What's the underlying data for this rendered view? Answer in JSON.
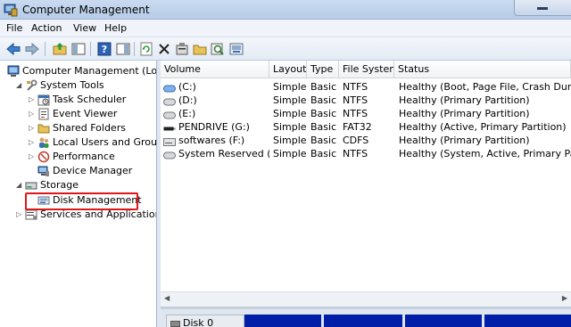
{
  "window": {
    "title": "Computer Management"
  },
  "menubar": {
    "items": [
      "File",
      "Action",
      "View",
      "Help"
    ]
  },
  "toolbar": {
    "icons": [
      "back-arrow-icon",
      "forward-arrow-icon",
      "up-folder-icon",
      "show-hide-tree-icon",
      "help-icon",
      "console-tree-icon",
      "refresh-icon",
      "delete-icon",
      "properties-icon",
      "open-folder-icon",
      "search-disk-icon",
      "disk-icon"
    ]
  },
  "tree": {
    "root": "Computer Management (Local",
    "system_tools": "System Tools",
    "task_scheduler": "Task Scheduler",
    "event_viewer": "Event Viewer",
    "shared_folders": "Shared Folders",
    "local_users": "Local Users and Groups",
    "performance": "Performance",
    "device_manager": "Device Manager",
    "storage": "Storage",
    "disk_management": "Disk Management",
    "services": "Services and Applications"
  },
  "volumes": {
    "columns": [
      "Volume",
      "Layout",
      "Type",
      "File System",
      "Status"
    ],
    "rows": [
      {
        "icon": "hdd-blue-icon",
        "volume": "(C:)",
        "layout": "Simple",
        "type": "Basic",
        "fs": "NTFS",
        "status": "Healthy (Boot, Page File, Crash Dump, Pri"
      },
      {
        "icon": "hdd-gray-icon",
        "volume": "(D:)",
        "layout": "Simple",
        "type": "Basic",
        "fs": "NTFS",
        "status": "Healthy (Primary Partition)"
      },
      {
        "icon": "hdd-gray-icon",
        "volume": "(E:)",
        "layout": "Simple",
        "type": "Basic",
        "fs": "NTFS",
        "status": "Healthy (Primary Partition)"
      },
      {
        "icon": "usb-drive-icon",
        "volume": "PENDRIVE (G:)",
        "layout": "Simple",
        "type": "Basic",
        "fs": "FAT32",
        "status": "Healthy (Active, Primary Partition)"
      },
      {
        "icon": "cd-drive-icon",
        "volume": "softwares (F:)",
        "layout": "Simple",
        "type": "Basic",
        "fs": "CDFS",
        "status": "Healthy (Primary Partition)"
      },
      {
        "icon": "hdd-gray-icon",
        "volume": "System Reserved (H:)",
        "layout": "Simple",
        "type": "Basic",
        "fs": "NTFS",
        "status": "Healthy (System, Active, Primary Partition"
      }
    ]
  },
  "disk_view": {
    "disk0_label": "Disk 0"
  },
  "colors": {
    "highlight_border": "#e0161b",
    "partition_bar": "#001ea8",
    "titlebar": "#c9daf0"
  }
}
